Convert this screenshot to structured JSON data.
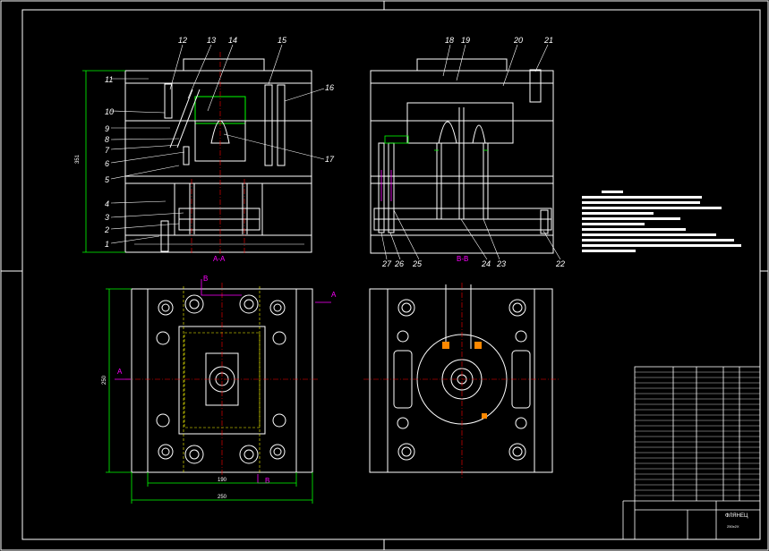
{
  "sheet": {
    "background": "#000000",
    "line_color": "#ffffff",
    "dimension_color": "#00ff00",
    "centerline_color": "#ff0000",
    "section_label_color": "#ff00ff",
    "hidden_line_color": "#ffff00"
  },
  "section_labels": {
    "view_aa": "A-A",
    "view_bb": "B-B",
    "cut_a": "A",
    "cut_b": "B"
  },
  "callouts": {
    "left_view": [
      "1",
      "2",
      "3",
      "4",
      "5",
      "6",
      "7",
      "8",
      "9",
      "10",
      "11",
      "12",
      "13",
      "14",
      "15",
      "16",
      "17"
    ],
    "right_view": [
      "18",
      "19",
      "20",
      "21",
      "22",
      "23",
      "24",
      "25",
      "26",
      "27"
    ]
  },
  "dimensions": {
    "height_left": "351",
    "plate_width_inner": "190",
    "plate_width_outer": "250",
    "plate_height_left": "250"
  },
  "title_block": {
    "name": "ФЛЯНЕЦ",
    "code": "250x2X"
  }
}
